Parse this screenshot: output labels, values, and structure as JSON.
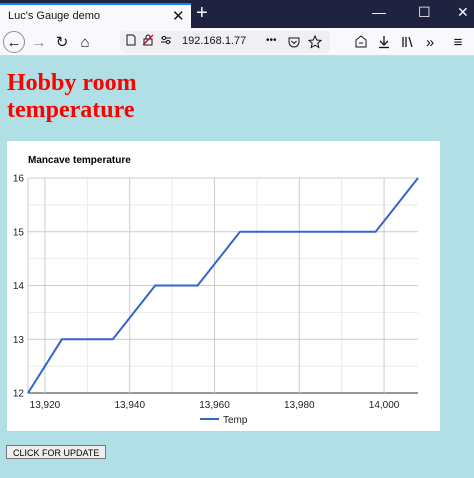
{
  "browser": {
    "tab_title": "Luc's Gauge demo",
    "tab_close_glyph": "✕",
    "new_tab_glyph": "+",
    "url": "192.168.1.77",
    "url_more_glyph": "•••",
    "window_controls": {
      "minimize": "—",
      "maximize": "☐",
      "close": "✕"
    },
    "nav_glyphs": {
      "back": "←",
      "forward": "→",
      "reload": "↻",
      "home": "⌂",
      "overflow": "»",
      "menu": "≡"
    }
  },
  "page": {
    "heading": "Hobby room temperature",
    "button_label": "CLICK FOR UPDATE",
    "background": "#b0e0e6",
    "heading_color": "#ff0000"
  },
  "chart_data": {
    "type": "line",
    "title": "Mancave temperature",
    "xlabel": "",
    "ylabel": "",
    "series": [
      {
        "name": "Temp",
        "color": "#3366cc",
        "points": [
          [
            13916,
            12
          ],
          [
            13924,
            13
          ],
          [
            13936,
            13
          ],
          [
            13946,
            14
          ],
          [
            13956,
            14
          ],
          [
            13966,
            15
          ],
          [
            13998,
            15
          ],
          [
            14008,
            16
          ]
        ]
      }
    ],
    "xlim": [
      13916,
      14008
    ],
    "ylim": [
      12,
      16
    ],
    "xticks": [
      13920,
      13940,
      13960,
      13980,
      14000
    ],
    "xtick_labels": [
      "13,920",
      "13,940",
      "13,960",
      "13,980",
      "14,000"
    ],
    "yticks": [
      12,
      13,
      14,
      15,
      16
    ],
    "ytick_labels": [
      "12",
      "13",
      "14",
      "15",
      "16"
    ],
    "grid": true,
    "legend": "bottom"
  }
}
